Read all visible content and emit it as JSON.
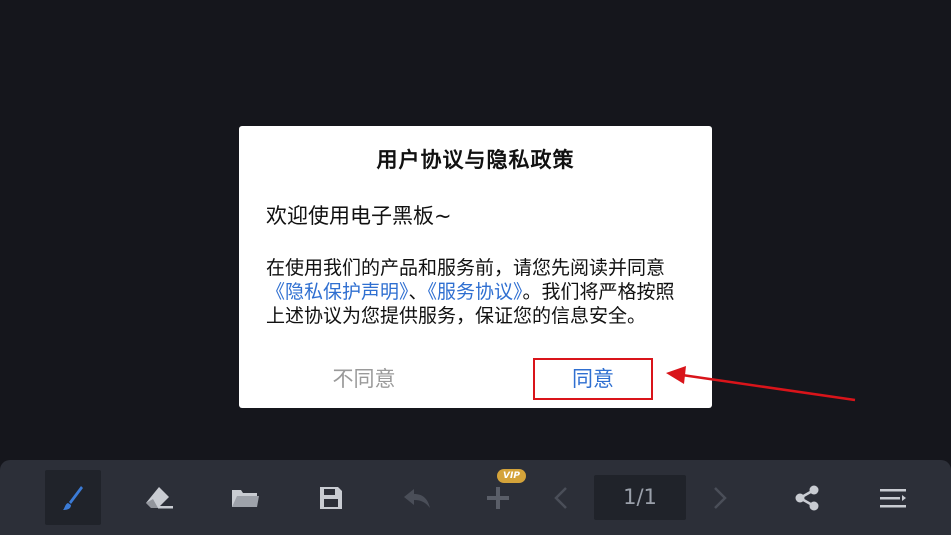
{
  "dialog": {
    "title": "用户协议与隐私政策",
    "welcome": "欢迎使用电子黑板~",
    "body_prefix": "在使用我们的产品和服务前，请您先阅读并同意",
    "privacy_link": "《隐私保护声明》",
    "separator": "、",
    "service_link": "《服务协议》",
    "body_suffix": "。我们将严格按照上述协议为您提供服务，保证您的信息安全。",
    "disagree_label": "不同意",
    "agree_label": "同意"
  },
  "toolbar": {
    "page_indicator": "1/1",
    "vip_badge": "VIP",
    "tools": [
      "brush-icon",
      "eraser-icon",
      "folder-icon",
      "save-icon",
      "undo-icon",
      "add-page-icon",
      "prev-page-icon",
      "next-page-icon",
      "share-icon",
      "menu-icon"
    ]
  },
  "colors": {
    "background": "#15161c",
    "toolbar": "#2c2f38",
    "link": "#2f6fd1",
    "highlight_box": "#d9141a",
    "brush_active": "#3b7bd6",
    "vip": "#d4a33a"
  }
}
